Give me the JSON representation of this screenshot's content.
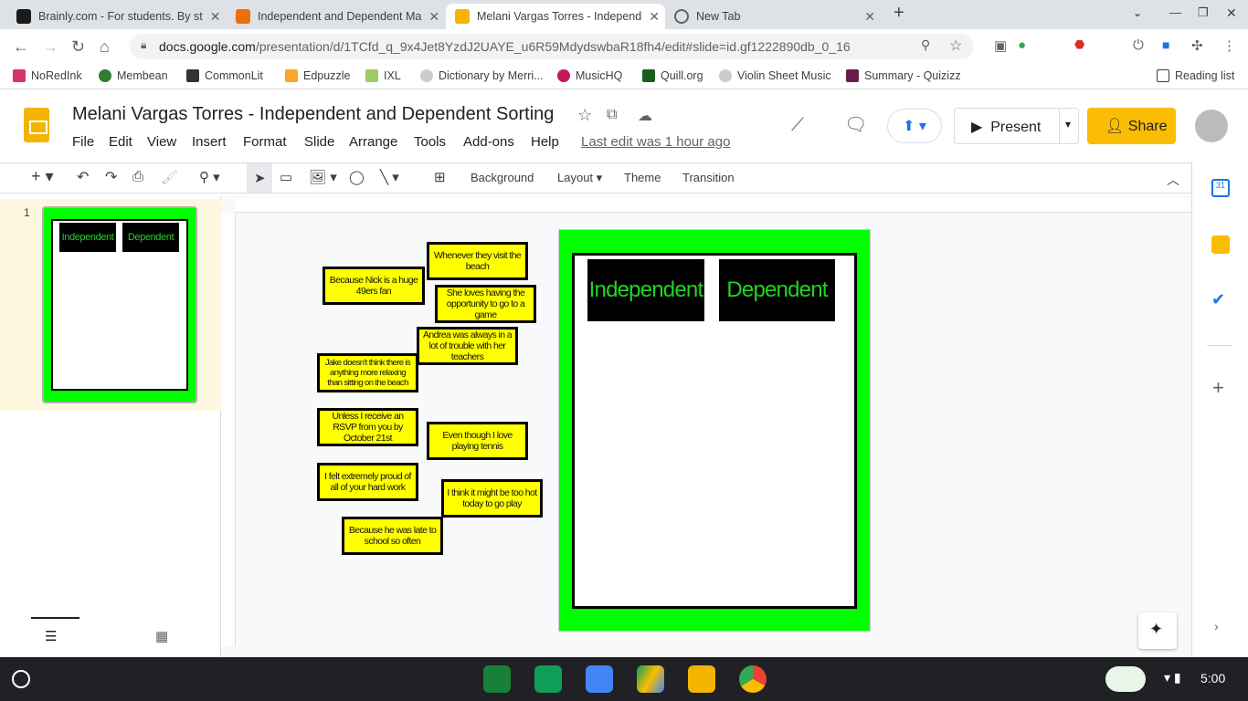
{
  "browser": {
    "tabs": [
      {
        "title": "Brainly.com - For students. By st",
        "color": "#1a1a1a"
      },
      {
        "title": "Independent and Dependent Ma",
        "color": "#e8710a"
      },
      {
        "title": "Melani Vargas Torres - Independ",
        "color": "#f4b400"
      },
      {
        "title": "New Tab",
        "color": "#5f6368"
      }
    ],
    "url_host": "docs.google.com",
    "url_path": "/presentation/d/1TCfd_q_9x4Jet8YzdJ2UAYE_u6R59MdydswbaR18fh4/edit#slide=id.gf1222890db_0_16",
    "bookmarks": [
      "NoRedInk",
      "Membean",
      "CommonLit",
      "Edpuzzle",
      "IXL",
      "Dictionary by Merri...",
      "MusicHQ",
      "Quill.org",
      "Violin Sheet Music",
      "Summary - Quizizz"
    ],
    "reading_list": "Reading list"
  },
  "doc": {
    "title": "Melani Vargas Torres - Independent and Dependent Sorting",
    "menu": [
      "File",
      "Edit",
      "View",
      "Insert",
      "Format",
      "Slide",
      "Arrange",
      "Tools",
      "Add-ons",
      "Help"
    ],
    "last_edit": "Last edit was 1 hour ago",
    "present": "Present",
    "share": "Share"
  },
  "toolbar": {
    "background": "Background",
    "layout": "Layout",
    "theme": "Theme",
    "transition": "Transition"
  },
  "filmstrip": {
    "slide_number": "1"
  },
  "slide": {
    "headers": [
      "Independent",
      "Dependent"
    ],
    "cards": [
      "Whenever they visit the beach",
      "Because Nick is a huge 49ers fan",
      "She loves having the opportunity to go to a game",
      "Andrea was always in a lot of trouble with her teachers",
      "Jake doesn't think there is anything more relaxing than sitting on the beach",
      "Unless I receive an RSVP from you by October 21st",
      "Even though I love playing tennis",
      "I felt extremely proud of all of your hard work",
      "I think it might be too hot today to go play",
      "Because he was late to school so often"
    ]
  },
  "shelf": {
    "time": "5:00"
  },
  "colors": {
    "slide_bg": "#00ff00",
    "card": "#ffff00",
    "header_text": "#22d422",
    "share": "#fbbc04"
  }
}
